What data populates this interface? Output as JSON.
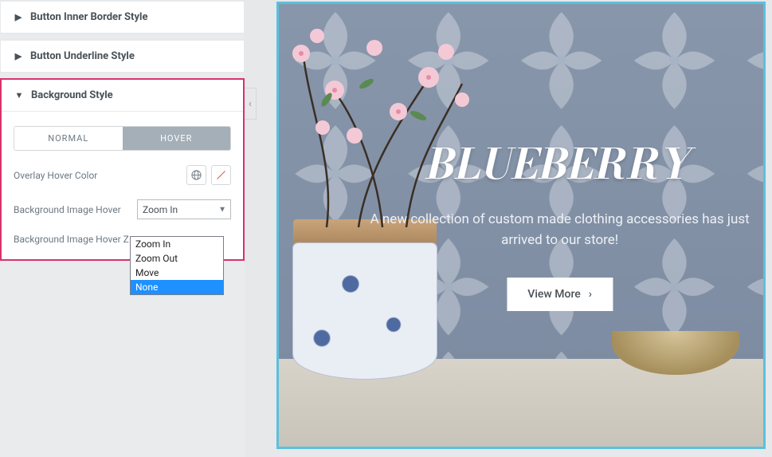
{
  "sidebar": {
    "sections": {
      "innerBorder": "Button Inner Border Style",
      "underline": "Button Underline Style",
      "background": "Background Style"
    },
    "tabs": {
      "normal": "Normal",
      "hover": "Hover"
    },
    "controls": {
      "overlayHoverColor": "Overlay Hover Color",
      "bgImageHover": "Background Image Hover",
      "bgImageHoverZ": "Background Image Hover Z",
      "selected": "Zoom In",
      "options": [
        "Zoom In",
        "Zoom Out",
        "Move",
        "None"
      ],
      "highlighted": "None"
    }
  },
  "preview": {
    "title": "BLUEBERRY",
    "subtitle": "A new collection of custom made clothing accessories has just arrived to our store!",
    "button": "View More"
  }
}
